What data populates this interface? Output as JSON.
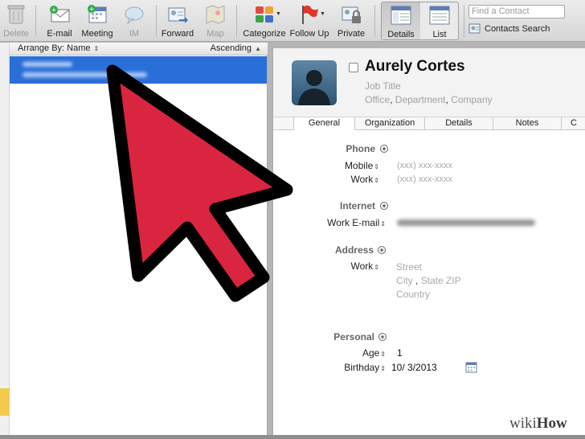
{
  "toolbar": {
    "delete": "Delete",
    "email": "E-mail",
    "meeting": "Meeting",
    "im": "IM",
    "forward": "Forward",
    "map": "Map",
    "categorize": "Categorize",
    "follow_up": "Follow Up",
    "private": "Private",
    "details": "Details",
    "list": "List",
    "search_placeholder": "Find a Contact",
    "contacts_search": "Contacts Search"
  },
  "list": {
    "arrange_by": "Arrange By: Name",
    "order": "Ascending"
  },
  "contact": {
    "name": "Aurely Cortes",
    "job_title": "Job Title",
    "office": "Office",
    "department": "Department",
    "company": "Company"
  },
  "tabs": [
    "General",
    "Organization",
    "Details",
    "Notes",
    "C"
  ],
  "sections": {
    "phone": "Phone",
    "mobile_label": "Mobile",
    "work_label": "Work",
    "phone_placeholder": "(xxx) xxx-xxxx",
    "internet": "Internet",
    "work_email_label": "Work E-mail",
    "address": "Address",
    "address_work_label": "Work",
    "street": "Street",
    "city": "City",
    "state_zip": "State ZIP",
    "country": "Country",
    "personal": "Personal",
    "age_label": "Age",
    "age_value": "1",
    "birthday_label": "Birthday",
    "birthday_value": "10/  3/2013"
  },
  "branding": {
    "wiki": "wiki",
    "how": "How"
  },
  "colors": {
    "selection": "#2a6fd8",
    "arrow_fill": "#d9253f",
    "arrow_stroke": "#000000"
  }
}
